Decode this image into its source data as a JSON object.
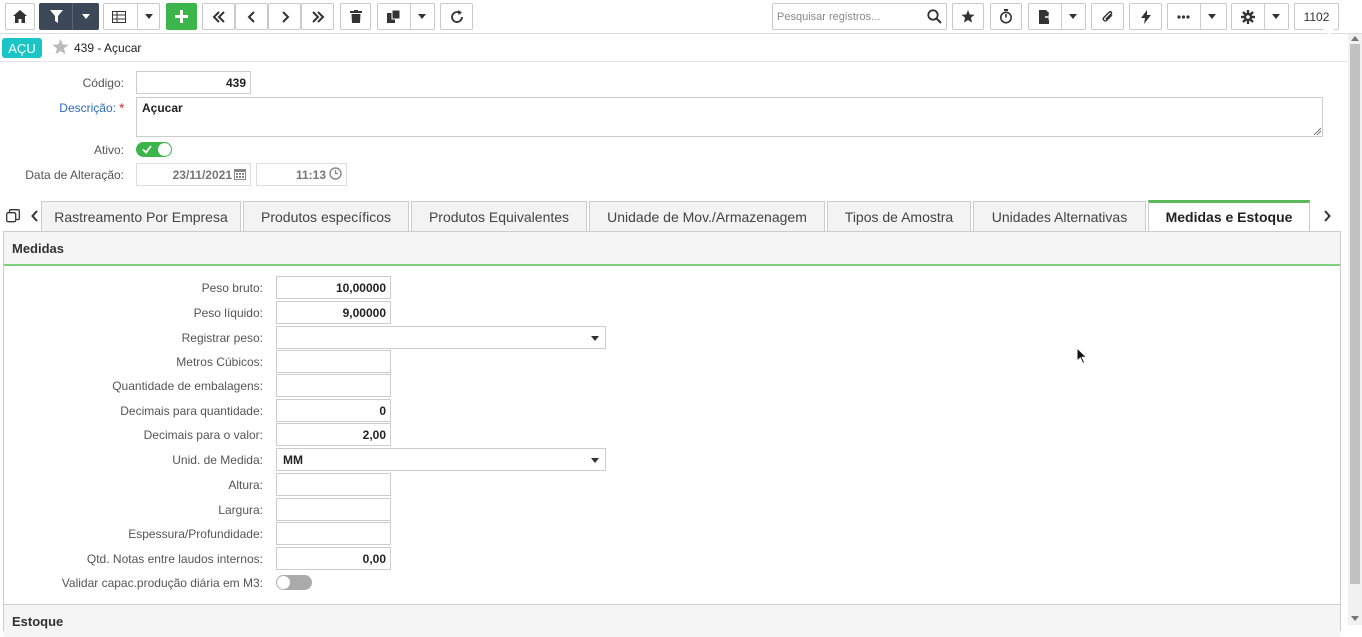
{
  "toolbar": {
    "search_placeholder": "Pesquisar registros...",
    "record_count": "1102"
  },
  "header": {
    "badge": "AÇU",
    "title": "439 - Açucar"
  },
  "form": {
    "codigo_label": "Código:",
    "codigo_value": "439",
    "descricao_label": "Descrição:",
    "descricao_required": "*",
    "descricao_value": "Açucar",
    "ativo_label": "Ativo:",
    "ativo_on": true,
    "data_alteracao_label": "Data de Alteração:",
    "data_value": "23/11/2021",
    "hora_value": "11:13"
  },
  "tabs": [
    {
      "label": "Rastreamento Por Empresa",
      "active": false
    },
    {
      "label": "Produtos específicos",
      "active": false
    },
    {
      "label": "Produtos Equivalentes",
      "active": false
    },
    {
      "label": "Unidade de Mov./Armazenagem",
      "active": false
    },
    {
      "label": "Tipos de Amostra",
      "active": false
    },
    {
      "label": "Unidades Alternativas",
      "active": false
    },
    {
      "label": "Medidas e Estoque",
      "active": true
    }
  ],
  "medidas": {
    "section_title": "Medidas",
    "peso_bruto_label": "Peso bruto:",
    "peso_bruto_value": "10,00000",
    "peso_liquido_label": "Peso líquido:",
    "peso_liquido_value": "9,00000",
    "registrar_peso_label": "Registrar peso:",
    "registrar_peso_value": "",
    "metros_cubicos_label": "Metros Cúbicos:",
    "metros_cubicos_value": "",
    "qtd_embalagens_label": "Quantidade de embalagens:",
    "qtd_embalagens_value": "",
    "decimais_qtd_label": "Decimais para quantidade:",
    "decimais_qtd_value": "0",
    "decimais_valor_label": "Decimais para o valor:",
    "decimais_valor_value": "2,00",
    "unid_medida_label": "Unid. de Medida:",
    "unid_medida_value": "MM",
    "altura_label": "Altura:",
    "altura_value": "",
    "largura_label": "Largura:",
    "largura_value": "",
    "espessura_label": "Espessura/Profundidade:",
    "espessura_value": "",
    "qtd_notas_label": "Qtd. Notas entre laudos internos:",
    "qtd_notas_value": "0,00",
    "validar_label": "Validar capac.produção diária em M3:",
    "validar_on": false
  },
  "estoque": {
    "section_title": "Estoque"
  },
  "colors": {
    "accent_green": "#3cb54a",
    "badge_teal": "#1cc5c5",
    "toolbar_dark": "#3c4858",
    "required_red": "#d9534f",
    "link_blue": "#2b6cc4"
  }
}
